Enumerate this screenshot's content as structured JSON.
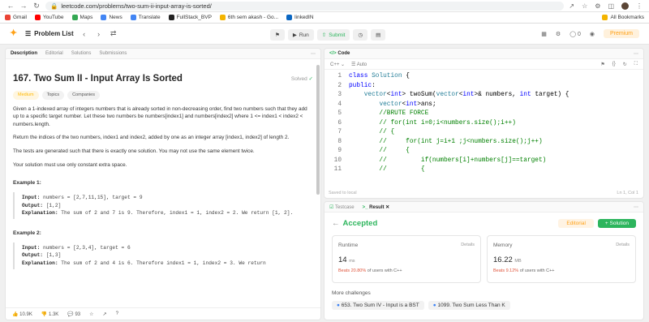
{
  "browser": {
    "url": "leetcode.com/problems/two-sum-ii-input-array-is-sorted/",
    "bookmarks": [
      {
        "label": "Gmail",
        "color": "#ea4335"
      },
      {
        "label": "YouTube",
        "color": "#ff0000"
      },
      {
        "label": "Maps",
        "color": "#34a853"
      },
      {
        "label": "News",
        "color": "#4285f4"
      },
      {
        "label": "Translate",
        "color": "#4285f4"
      },
      {
        "label": "FullStack_BVP",
        "color": "#222222"
      },
      {
        "label": "6th sem akash - Go...",
        "color": "#f4b400"
      },
      {
        "label": "linkedIN",
        "color": "#0a66c2"
      }
    ],
    "all_bookmarks": "All Bookmarks"
  },
  "toolbar": {
    "problem_list": "Problem List",
    "run": "Run",
    "submit": "Submit",
    "coins": "0",
    "premium": "Premium"
  },
  "left": {
    "tabs": [
      "Description",
      "Editorial",
      "Solutions",
      "Submissions"
    ],
    "title": "167. Two Sum II - Input Array Is Sorted",
    "solved": "Solved",
    "tags": [
      "Medium",
      "Topics",
      "Companies"
    ],
    "p1": "Given a 1-indexed array of integers numbers that is already sorted in non-decreasing order, find two numbers such that they add up to a specific target number. Let these two numbers be numbers[index1] and numbers[index2] where 1 <= index1 < index2 < numbers.length.",
    "p2": "Return the indices of the two numbers, index1 and index2, added by one as an integer array [index1, index2] of length 2.",
    "p3": "The tests are generated such that there is exactly one solution. You may not use the same element twice.",
    "p4": "Your solution must use only constant extra space.",
    "examples": [
      {
        "title": "Example 1:",
        "input": "numbers = [2,7,11,15], target = 9",
        "output": "[1,2]",
        "explanation": "The sum of 2 and 7 is 9. Therefore, index1 = 1, index2 = 2. We return [1, 2]."
      },
      {
        "title": "Example 2:",
        "input": "numbers = [2,3,4], target = 6",
        "output": "[1,3]",
        "explanation": "The sum of 2 and 4 is 6. Therefore index1 = 1, index2 = 3. We return"
      }
    ],
    "footer": {
      "likes": "10.9K",
      "dislikes": "1.3K",
      "comments": "93"
    }
  },
  "code": {
    "tab": "Code",
    "language": "C++",
    "mode": "Auto",
    "lines": [
      "class Solution {",
      "public:",
      "    vector<int> twoSum(vector<int>& numbers, int target) {",
      "        vector<int>ans;",
      "        //BRUTE FORCE",
      "        // for(int i=0;i<numbers.size();i++)",
      "        // {",
      "        //     for(int j=i+1 ;j<numbers.size();j++)",
      "        //     {",
      "        //         if(numbers[i]+numbers[j]==target)",
      "        //         {"
    ],
    "saved": "Saved to local",
    "position": "Ln 1, Col 1"
  },
  "result": {
    "tabs": [
      "Testcase",
      "Result"
    ],
    "status": "Accepted",
    "editorial": "Editorial",
    "solution": "+ Solution",
    "runtime": {
      "label": "Runtime",
      "details": "Details",
      "value": "14",
      "unit": "ms",
      "beats": "Beats 20.80%",
      "suffix": "of users with C++"
    },
    "memory": {
      "label": "Memory",
      "details": "Details",
      "value": "16.22",
      "unit": "MB",
      "beats": "Beats 9.12%",
      "suffix": "of users with C++"
    },
    "more": "More challenges",
    "challenges": [
      "653. Two Sum IV - Input is a BST",
      "1099. Two Sum Less Than K"
    ]
  },
  "colors": {
    "accent": "#ffa116",
    "success": "#2db55d",
    "danger": "#e0553c"
  }
}
